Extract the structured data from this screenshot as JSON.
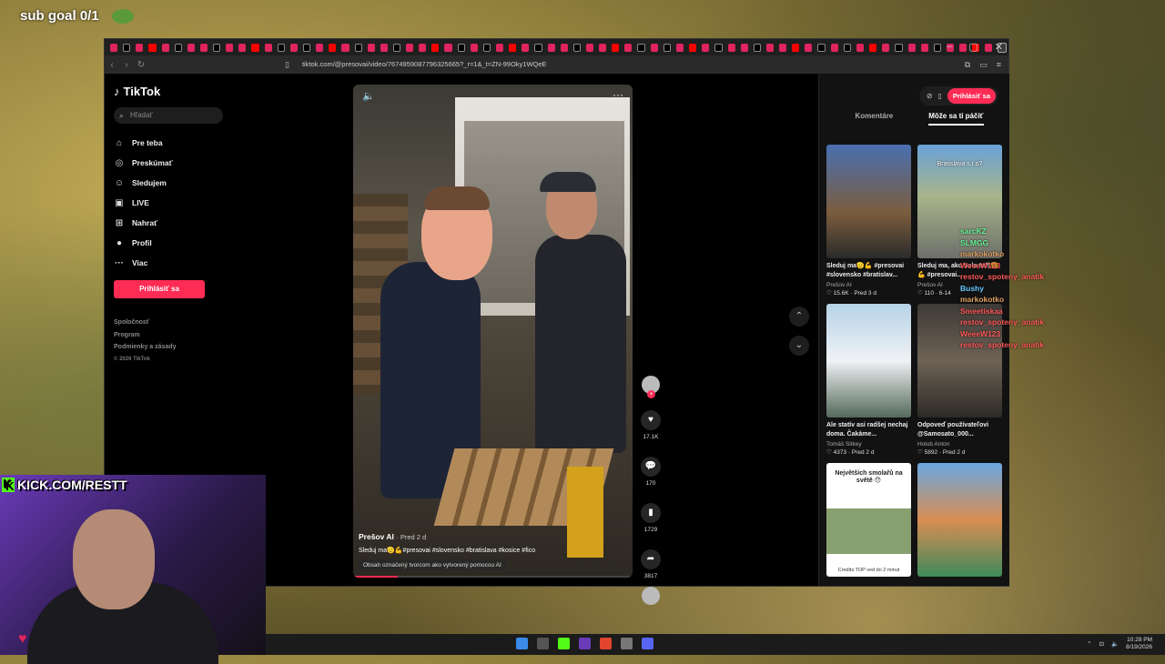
{
  "overlay": {
    "sub_goal": "sub goal 0/1",
    "kick_handle": "KICK.COM/RESTT"
  },
  "browser": {
    "url": "tiktok.com/@presovai/video/7674959087796325665?_r=1&_t=ZN-99Oky1WQeE",
    "window_controls": [
      "–",
      "▢",
      "✕"
    ]
  },
  "sidebar": {
    "logo": "TikTok",
    "search_placeholder": "Hľadať",
    "items": [
      {
        "label": "Pre teba",
        "icon": "home-icon"
      },
      {
        "label": "Preskúmať",
        "icon": "compass-icon"
      },
      {
        "label": "Sledujem",
        "icon": "following-icon"
      },
      {
        "label": "LIVE",
        "icon": "live-icon"
      },
      {
        "label": "Nahrať",
        "icon": "upload-icon"
      },
      {
        "label": "Profil",
        "icon": "profile-icon"
      },
      {
        "label": "Viac",
        "icon": "more-icon"
      }
    ],
    "login_button": "Prihlásiť sa",
    "footer": [
      "Spoločnosť",
      "Program",
      "Podmienky a zásady"
    ],
    "copyright": "© 2026 TikTok"
  },
  "video": {
    "author": "Prešov AI",
    "posted": "· Pred 2 d",
    "description": "Sleduj ma🫡💪#presovai #slovensko #bratislava #kosice #fico",
    "ai_label": "Obsah označený tvorcom ako vytvorený pomocou AI",
    "progress": 0.16,
    "likes": "17.1K",
    "comments": "170",
    "saves": "1729",
    "shares": "3817"
  },
  "right_panel": {
    "login": "Prihlásiť sa",
    "tabs": [
      "Komentáre",
      "Môže sa ti páčiť"
    ],
    "cards": [
      {
        "title": "Sleduj ma🫡💪 #presovai #slovensko #bratislav...",
        "author": "Prešov AI",
        "stats": "♡ 15.6K · Pred 3 d"
      },
      {
        "title": "Sleduj ma, ako bolo tuff 🫡💪 #presovai...",
        "author": "Prešov AI",
        "stats": "♡ 110 · 6-14",
        "caption": "Bratislava s.r.o?"
      },
      {
        "title": "Ale statív asi radšej nechaj doma. Čakáme...",
        "author": "Tomáš Sitkey",
        "stats": "♡ 4373 · Pred 2 d"
      },
      {
        "title": "Odpoveď používateľovi @Samosato_000...",
        "author": "Holub Anton",
        "stats": "♡ 5892 · Pred 2 d"
      },
      {
        "title": "",
        "author": "",
        "stats": "",
        "caption": "Největších smolařů na světě 😯",
        "small": "Credits:TOP ved do 2 minut"
      },
      {
        "title": "",
        "author": "",
        "stats": ""
      }
    ]
  },
  "chat": [
    {
      "name": "sarcKZ",
      "color": "#6cf59a"
    },
    {
      "name": "SLMGG",
      "color": "#6cf59a"
    },
    {
      "name": "markokotko",
      "color": "#e0a060"
    },
    {
      "name": "WeeeW123",
      "color": "#ff5a5a"
    },
    {
      "name": "restov_spoteny_anatik",
      "color": "#ff5a5a"
    },
    {
      "name": "Bushy",
      "color": "#6ac8ff"
    },
    {
      "name": "markokotko",
      "color": "#e0a060"
    },
    {
      "name": "Smeetiskaa",
      "color": "#ff5a5a"
    },
    {
      "name": "restov_spoteny_anatik",
      "color": "#ff5a5a"
    },
    {
      "name": "WeeeW123",
      "color": "#ff5a5a"
    },
    {
      "name": "restov_spoteny_anatik",
      "color": "#ff5a5a"
    }
  ],
  "taskbar": {
    "time": "10:28 PM",
    "date": "8/19/2026"
  }
}
